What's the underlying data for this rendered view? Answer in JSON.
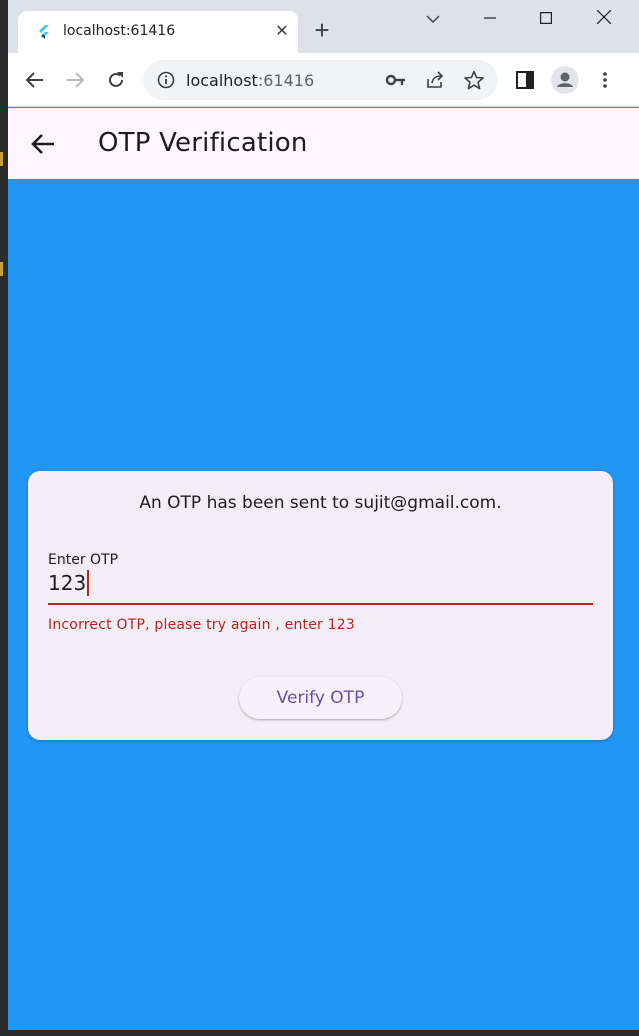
{
  "browser": {
    "tab_title": "localhost:61416",
    "url_host": "localhost",
    "url_port": ":61416",
    "new_tab_symbol": "+",
    "close_symbol": "✕"
  },
  "app": {
    "title": "OTP Verification",
    "background_color": "#2196f3",
    "appbar_color": "#fef7ff"
  },
  "card": {
    "message": "An OTP has been sent to sujit@gmail.com.",
    "otp_field": {
      "label": "Enter OTP",
      "value": "123"
    },
    "error": "Incorrect OTP, please try again , enter 123",
    "error_color": "#b3261e",
    "verify_button": "Verify OTP",
    "accent_color": "#6750a4"
  },
  "icons": {
    "back": "arrow-left-icon",
    "forward": "arrow-right-icon",
    "reload": "reload-icon",
    "site_info": "info-icon",
    "password": "key-icon",
    "share": "share-icon",
    "bookmark": "star-icon",
    "side_panel": "side-panel-icon",
    "profile": "profile-icon",
    "menu": "kebab-menu-icon"
  }
}
